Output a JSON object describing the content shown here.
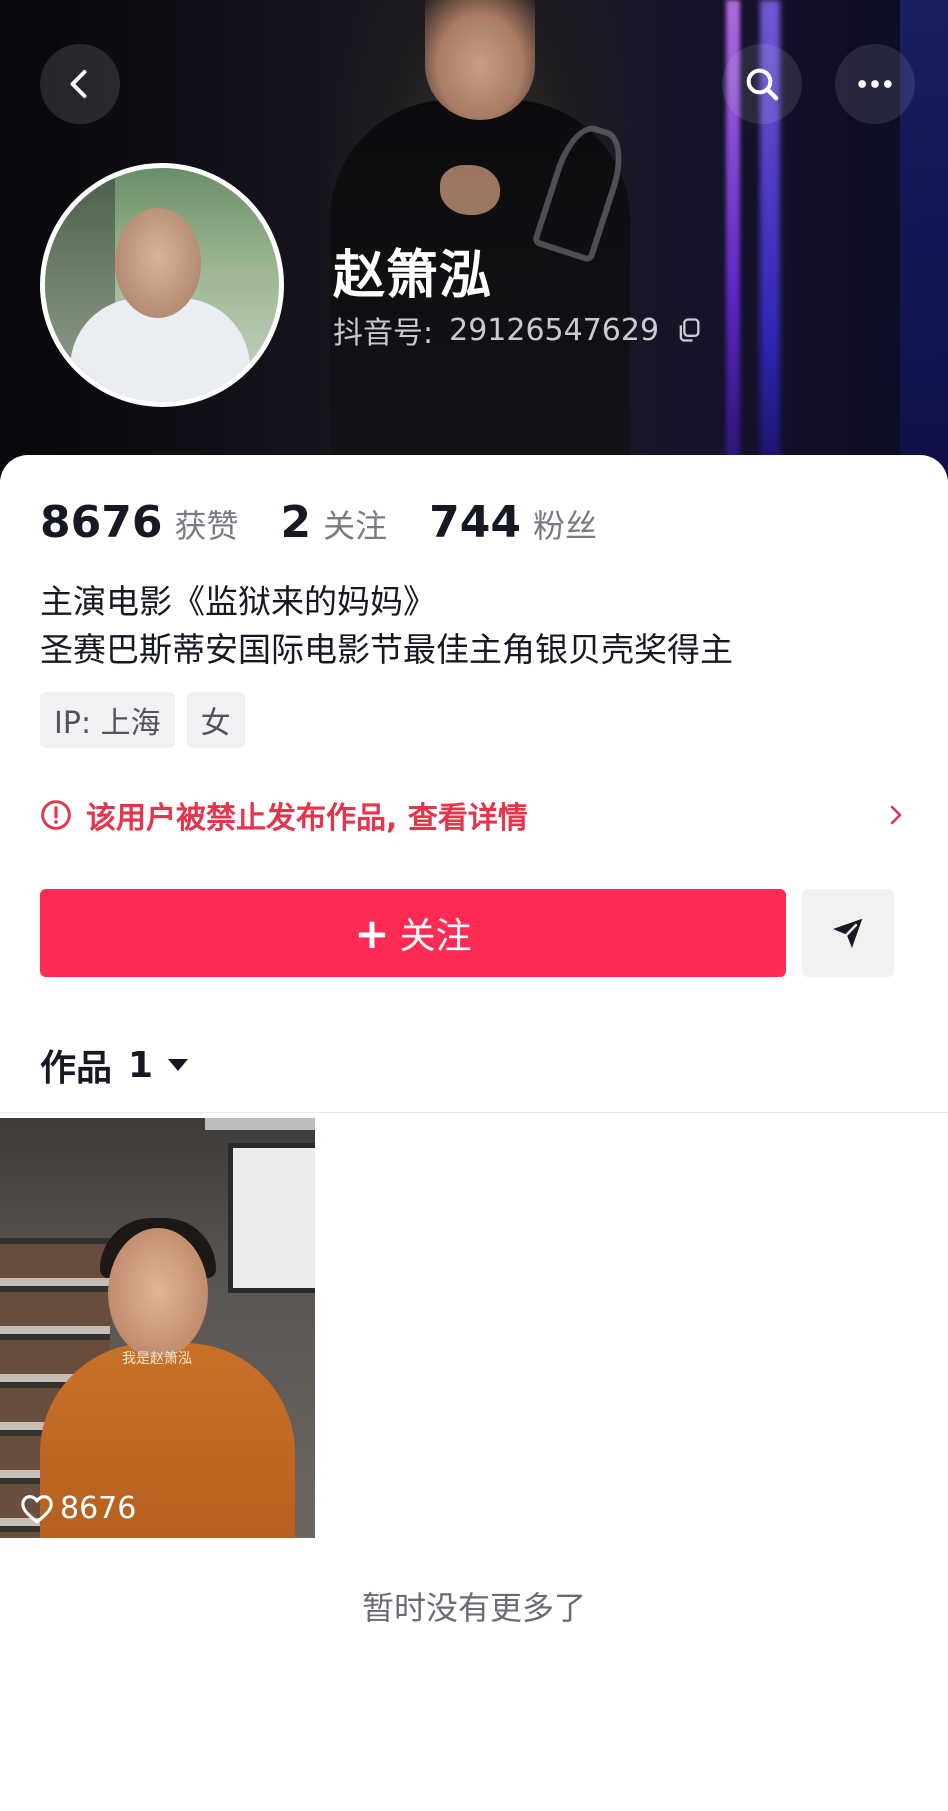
{
  "header": {
    "name": "赵箫泓",
    "douyin_id_label": "抖音号:",
    "douyin_id": "29126547629",
    "back_icon": "chevron-left-icon",
    "search_icon": "search-icon",
    "more_icon": "more-horizontal-icon"
  },
  "stats": [
    {
      "value": "8676",
      "label": "获赞"
    },
    {
      "value": "2",
      "label": "关注"
    },
    {
      "value": "744",
      "label": "粉丝"
    }
  ],
  "bio": {
    "line1": "主演电影《监狱来的妈妈》",
    "line2": "圣赛巴斯蒂安国际电影节最佳主角银贝壳奖得主"
  },
  "tags": {
    "ip": "IP: 上海",
    "gender": "女"
  },
  "notice": {
    "text": "该用户被禁止发布作品, 查看详情",
    "color": "#e5344c"
  },
  "actions": {
    "follow_plus": "+",
    "follow_label": "关注",
    "follow_color": "#fe2c55",
    "share_icon": "send-icon"
  },
  "works": {
    "label": "作品",
    "count": "1",
    "items": [
      {
        "caption": "我是赵箫泓",
        "likes": "8676"
      }
    ]
  },
  "footer": {
    "no_more": "暂时没有更多了"
  }
}
